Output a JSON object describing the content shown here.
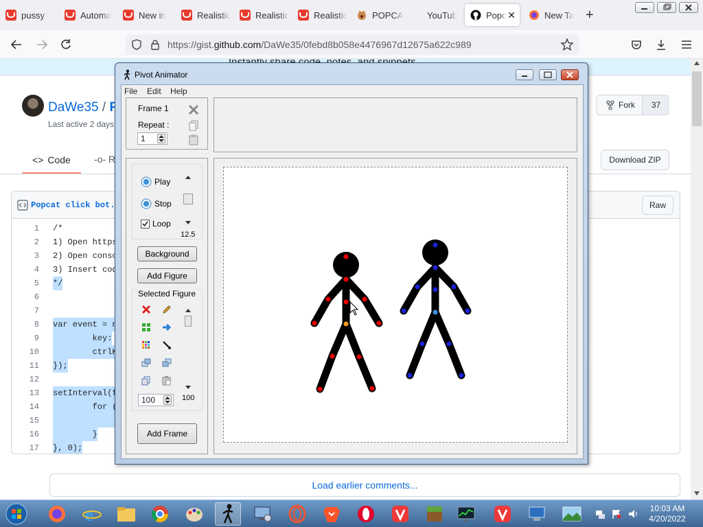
{
  "browser": {
    "tabs": [
      {
        "title": "pussy -",
        "icon": "red-favicon"
      },
      {
        "title": "Automa",
        "icon": "red-favicon"
      },
      {
        "title": "New in",
        "icon": "red-favicon"
      },
      {
        "title": "Realistic",
        "icon": "red-favicon"
      },
      {
        "title": "Realistic",
        "icon": "red-favicon"
      },
      {
        "title": "Realistic",
        "icon": "red-favicon"
      },
      {
        "title": "POPCA",
        "icon": "popcat-favicon"
      },
      {
        "title": "YouTub",
        "icon": "youtube-favicon"
      },
      {
        "title": "Popc",
        "icon": "github-favicon",
        "active": true
      },
      {
        "title": "New Ta",
        "icon": "firefox-favicon"
      }
    ],
    "url_prefix": "https://gist.",
    "url_domain": "github.com",
    "url_path": "/DaWe35/0febd8b058e4476967d12675a622c989"
  },
  "github": {
    "banner": "Instantly share code, notes, and snippets.",
    "owner": "DaWe35",
    "slash": "/",
    "gist_initial": "P",
    "last_active": "Last active 2 days a",
    "fork_label": "Fork",
    "fork_count": "37",
    "tab_code": "Code",
    "tab_revisions": "Re",
    "download_zip": "Download ZIP",
    "filename": "Popcat click bot.j",
    "raw_label": "Raw",
    "lines": [
      {
        "n": "1",
        "t": "/*",
        "hl": false
      },
      {
        "n": "2",
        "t": "1) Open https",
        "hl": false
      },
      {
        "n": "3",
        "t": "2) Open conso",
        "hl": false
      },
      {
        "n": "4",
        "t": "3) Insert cod",
        "hl": false
      },
      {
        "n": "5",
        "t": "*/",
        "hl": true
      },
      {
        "n": "6",
        "t": "",
        "hl": false
      },
      {
        "n": "7",
        "t": "",
        "hl": false
      },
      {
        "n": "8",
        "t": "var event = n",
        "hl": true
      },
      {
        "n": "9",
        "t": "        key:",
        "hl": true
      },
      {
        "n": "10",
        "t": "        ctrlK",
        "hl": true
      },
      {
        "n": "11",
        "t": "});",
        "hl": true
      },
      {
        "n": "12",
        "t": "",
        "hl": false
      },
      {
        "n": "13",
        "t": "setInterval(f",
        "hl": true
      },
      {
        "n": "14",
        "t": "        for (",
        "hl": true
      },
      {
        "n": "15",
        "t": "             ",
        "hl": true
      },
      {
        "n": "16",
        "t": "        }",
        "hl": true
      },
      {
        "n": "17",
        "t": "}, 0);",
        "hl": true
      }
    ],
    "load_earlier": "Load earlier comments..."
  },
  "pivot": {
    "title": "Pivot Animator",
    "menu": [
      "File",
      "Edit",
      "Help"
    ],
    "frame_label": "Frame 1",
    "repeat_label": "Repeat :",
    "repeat_value": "1",
    "play": "Play",
    "stop": "Stop",
    "loop": "Loop",
    "speed": "12.5",
    "background_btn": "Background",
    "add_figure_btn": "Add Figure",
    "selected_figure": "Selected Figure",
    "scale_value": "100",
    "scale_readout": "100",
    "add_frame_btn": "Add Frame"
  },
  "taskbar": {
    "time": "10:03 AM",
    "date": "4/20/2022"
  }
}
